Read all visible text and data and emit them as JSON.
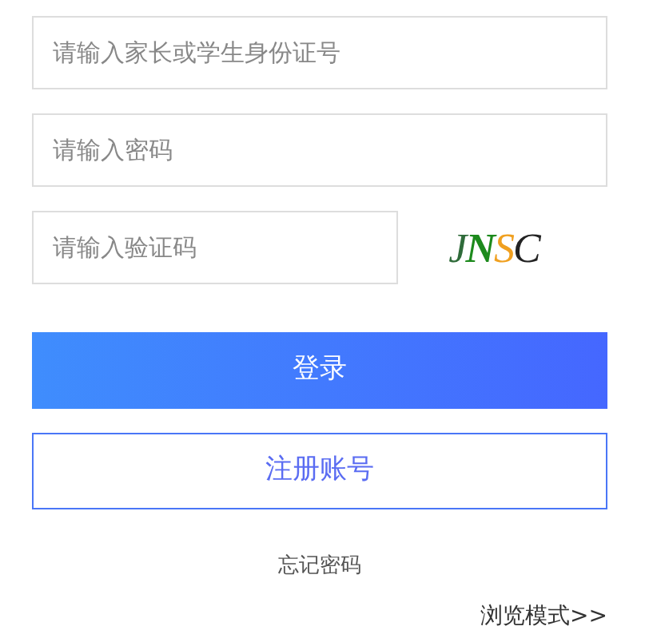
{
  "fields": [
    {
      "placeholder": "请输入家长或学生身份证号"
    },
    {
      "placeholder": "请输入密码"
    },
    {
      "placeholder": "请输入验证码"
    }
  ],
  "captcha": {
    "letters": [
      {
        "char": "J",
        "color": "#2f6b3a"
      },
      {
        "char": "N",
        "color": "#1d8a1d"
      },
      {
        "char": "S",
        "color": "#f0a020"
      },
      {
        "char": "C",
        "color": "#222222"
      }
    ]
  },
  "login_button": "登录",
  "register_button": "注册账号",
  "forgot_link": "忘记密码",
  "browse_link": "浏览模式>>"
}
